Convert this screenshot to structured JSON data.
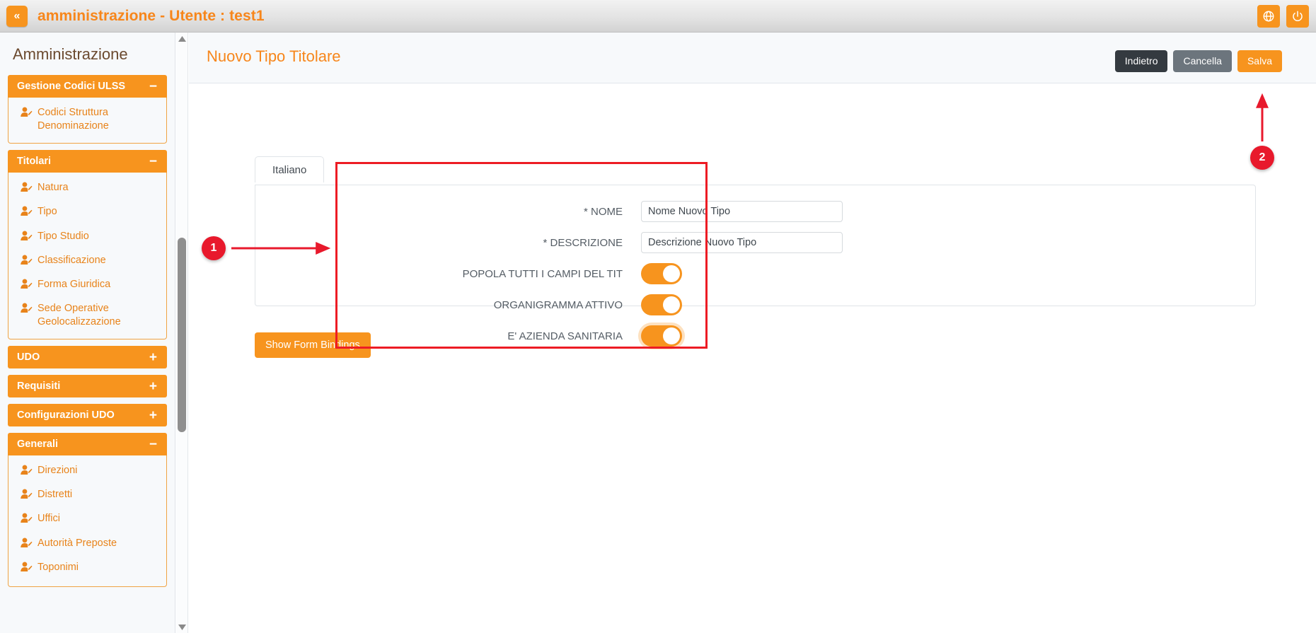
{
  "topbar": {
    "collapse_icon": "chevron-double-left-icon",
    "collapse_label": "«",
    "title": "amministrazione - Utente : test1",
    "globe_icon": "globe-icon",
    "power_icon": "power-icon",
    "accent_color": "#f7941e"
  },
  "sidebar": {
    "title": "Amministrazione",
    "groups": [
      {
        "label": "Gestione Codici ULSS",
        "sign": "−",
        "expanded": true,
        "items": [
          {
            "label": "Codici Struttura Denominazione",
            "icon": "user-edit-icon"
          }
        ]
      },
      {
        "label": "Titolari",
        "sign": "−",
        "expanded": true,
        "items": [
          {
            "label": "Natura",
            "icon": "user-edit-icon"
          },
          {
            "label": "Tipo",
            "icon": "user-edit-icon"
          },
          {
            "label": "Tipo Studio",
            "icon": "user-edit-icon"
          },
          {
            "label": "Classificazione",
            "icon": "user-edit-icon"
          },
          {
            "label": "Forma Giuridica",
            "icon": "user-edit-icon"
          },
          {
            "label": "Sede Operative Geolocalizzazione",
            "icon": "user-edit-icon"
          }
        ]
      },
      {
        "label": "UDO",
        "sign": "+",
        "expanded": false,
        "items": []
      },
      {
        "label": "Requisiti",
        "sign": "+",
        "expanded": false,
        "items": []
      },
      {
        "label": "Configurazioni UDO",
        "sign": "+",
        "expanded": false,
        "items": []
      },
      {
        "label": "Generali",
        "sign": "−",
        "expanded": true,
        "items": [
          {
            "label": "Direzioni",
            "icon": "user-edit-icon"
          },
          {
            "label": "Distretti",
            "icon": "user-edit-icon"
          },
          {
            "label": "Uffici",
            "icon": "user-edit-icon"
          },
          {
            "label": "Autorità Preposte",
            "icon": "user-edit-icon"
          },
          {
            "label": "Toponimi",
            "icon": "user-edit-icon"
          }
        ]
      }
    ],
    "scrollbar": {
      "up_icon": "triangle-up-icon",
      "down_icon": "triangle-down-icon"
    }
  },
  "page": {
    "title": "Nuovo Tipo Titolare",
    "actions": {
      "back_label": "Indietro",
      "cancel_label": "Cancella",
      "save_label": "Salva"
    }
  },
  "form": {
    "tabs": [
      {
        "label": "Italiano",
        "active": true
      }
    ],
    "fields": [
      {
        "type": "text",
        "label": "* NOME",
        "value": "Nome Nuovo Tipo",
        "name": "nome-field"
      },
      {
        "type": "text",
        "label": "* DESCRIZIONE",
        "value": "Descrizione Nuovo Tipo",
        "name": "descrizione-field"
      },
      {
        "type": "toggle",
        "label": "POPOLA TUTTI I CAMPI DEL TIT",
        "value": "on",
        "focused": false,
        "name": "popola-tutti-campi-toggle"
      },
      {
        "type": "toggle",
        "label": "ORGANIGRAMMA ATTIVO",
        "value": "on",
        "focused": false,
        "name": "organigramma-attivo-toggle"
      },
      {
        "type": "toggle",
        "label": "E' AZIENDA SANITARIA",
        "value": "on",
        "focused": true,
        "name": "azienda-sanitaria-toggle"
      }
    ],
    "bindings_button_label": "Show Form Bindings"
  },
  "annotations": {
    "callouts": [
      {
        "number": "1",
        "target": "form-highlight-box"
      },
      {
        "number": "2",
        "target": "save-button"
      }
    ],
    "highlight_color": "#ed1c24",
    "badge_color": "#e8192c"
  }
}
